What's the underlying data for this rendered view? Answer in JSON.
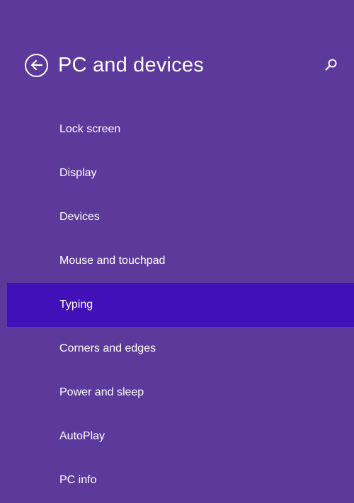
{
  "header": {
    "title": "PC and devices",
    "back_icon": "back-arrow-circle-icon",
    "search_icon": "search-icon"
  },
  "colors": {
    "background": "#5c3a9c",
    "selected": "#4110b8",
    "text": "#ffffff"
  },
  "nav": {
    "items": [
      {
        "label": "Lock screen"
      },
      {
        "label": "Display"
      },
      {
        "label": "Devices"
      },
      {
        "label": "Mouse and touchpad"
      },
      {
        "label": "Typing",
        "selected": true
      },
      {
        "label": "Corners and edges"
      },
      {
        "label": "Power and sleep"
      },
      {
        "label": "AutoPlay"
      },
      {
        "label": "PC info"
      }
    ]
  }
}
